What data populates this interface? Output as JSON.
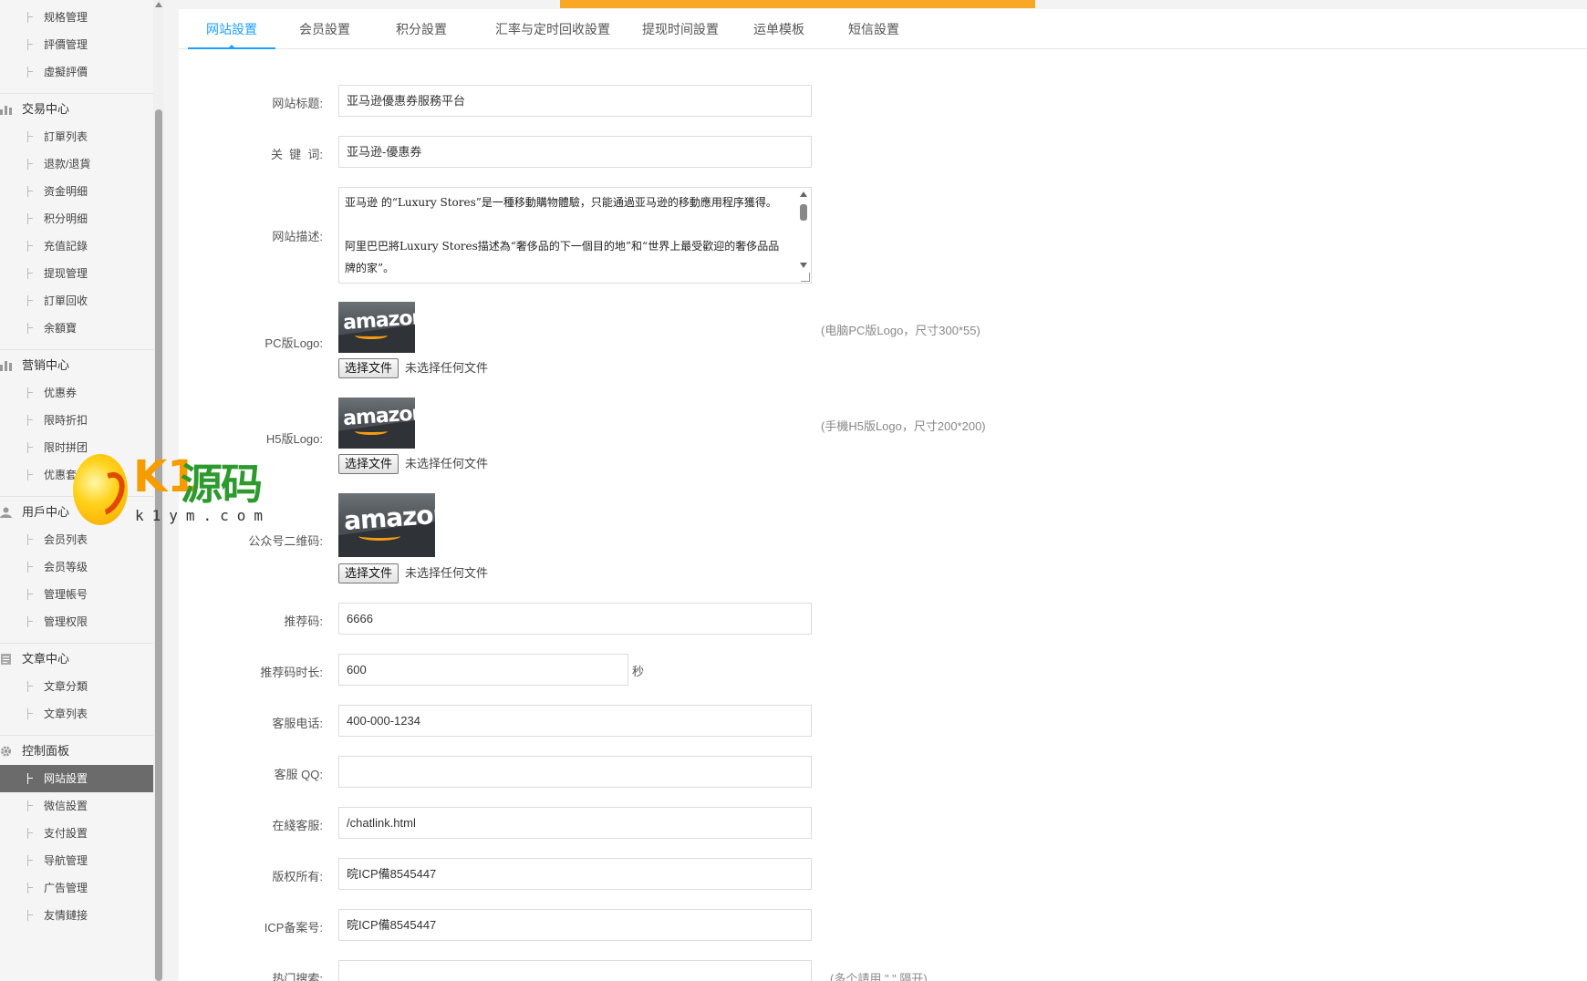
{
  "sidebar": {
    "top_items": [
      "规格管理",
      "評價管理",
      "虛擬評價"
    ],
    "groups": [
      {
        "title": "交易中心",
        "icon": "bar-chart-icon",
        "items": [
          "訂單列表",
          "退款/退貨",
          "资金明细",
          "积分明细",
          "充值記錄",
          "提现管理",
          "訂單回收",
          "余額寶"
        ]
      },
      {
        "title": "营销中心",
        "icon": "marketing-chart-icon",
        "items": [
          "优惠券",
          "限時折扣",
          "限时拼团",
          "优惠套餐"
        ]
      },
      {
        "title": "用戶中心",
        "icon": "user-icon",
        "items": [
          "会员列表",
          "会员等级",
          "管理帳号",
          "管理权限"
        ]
      },
      {
        "title": "文章中心",
        "icon": "document-icon",
        "items": [
          "文章分類",
          "文章列表"
        ]
      },
      {
        "title": "控制面板",
        "icon": "gear-icon",
        "items": [
          "网站設置",
          "微信設置",
          "支付設置",
          "导航管理",
          "广告管理",
          "友情鏈接"
        ]
      }
    ],
    "active_item": "网站設置"
  },
  "tabs": [
    "网站設置",
    "会员設置",
    "积分設置",
    "汇率与定时回收設置",
    "提现时间設置",
    "运单模板",
    "短信設置"
  ],
  "active_tab": "网站設置",
  "colors": {
    "accent": "#1e9fff",
    "top_bar": "#f9a825",
    "sidebar_active": "#6b6b6b"
  },
  "form": {
    "site_title": {
      "label": "网站标题:",
      "value": "亚马逊優惠券服務平台"
    },
    "keywords": {
      "label": "关  键  词:",
      "value": "亚马逊-優惠券"
    },
    "description": {
      "label": "网站描述:",
      "para1": "亚马逊 的“Luxury Stores”是一種移動購物體驗，只能通過亚马逊的移動應用程序獲得。",
      "para2": "阿里巴巴將Luxury Stores描述為“奢侈品的下一個目的地”和“世界上最受歡迎的奢侈品品牌的家”。"
    },
    "pc_logo": {
      "label": "PC版Logo:",
      "hint": "(电脑PC版Logo，尺寸300*55)",
      "button": "选择文件",
      "status": "未选择任何文件",
      "image_text": "amazon"
    },
    "h5_logo": {
      "label": "H5版Logo:",
      "hint": "(手機H5版Logo，尺寸200*200)",
      "button": "选择文件",
      "status": "未选择任何文件",
      "image_text": "amazon"
    },
    "qr_code": {
      "label": "公众号二维码:",
      "button": "选择文件",
      "status": "未选择任何文件",
      "image_text": "amazon"
    },
    "referral_code": {
      "label": "推荐码:",
      "value": "6666"
    },
    "referral_duration": {
      "label": "推荐码时长:",
      "value": "600",
      "unit": "秒"
    },
    "service_phone": {
      "label": "客服电话:",
      "value": "400-000-1234"
    },
    "service_qq": {
      "label": "客服 QQ:",
      "value": ""
    },
    "online_service": {
      "label": "在綫客服:",
      "value": "/chatlink.html"
    },
    "copyright": {
      "label": "版权所有:",
      "value": "晥ICP備8545447"
    },
    "icp": {
      "label": "ICP备案号:",
      "value": "晥ICP備8545447"
    },
    "hot_search": {
      "label": "热门搜索:",
      "value": "",
      "hint": "(多个請用 \",\" 隔开)"
    }
  },
  "watermark": {
    "brand": "K1",
    "name": "源码",
    "domain": "k1ym.com"
  }
}
